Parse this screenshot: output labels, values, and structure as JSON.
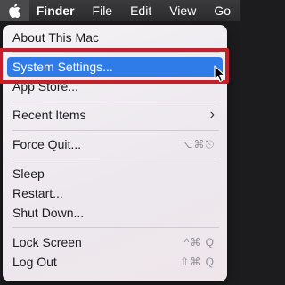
{
  "menubar": {
    "apple": "apple-icon",
    "items": [
      "Finder",
      "File",
      "Edit",
      "View",
      "Go"
    ]
  },
  "menu": {
    "items": [
      {
        "label": "About This Mac"
      },
      {
        "label": "System Settings...",
        "highlighted": true
      },
      {
        "label": "App Store..."
      },
      {
        "label": "Recent Items",
        "submenu": true
      },
      {
        "label": "Force Quit...",
        "shortcut": "⌥⌘⎋"
      },
      {
        "label": "Sleep"
      },
      {
        "label": "Restart..."
      },
      {
        "label": "Shut Down..."
      },
      {
        "label": "Lock Screen",
        "shortcut": "^⌘ Q"
      },
      {
        "label": "Log Out",
        "shortcut": "⇧⌘ Q"
      }
    ]
  },
  "colors": {
    "highlight": "#2f7be8",
    "callout": "#c4202c"
  }
}
